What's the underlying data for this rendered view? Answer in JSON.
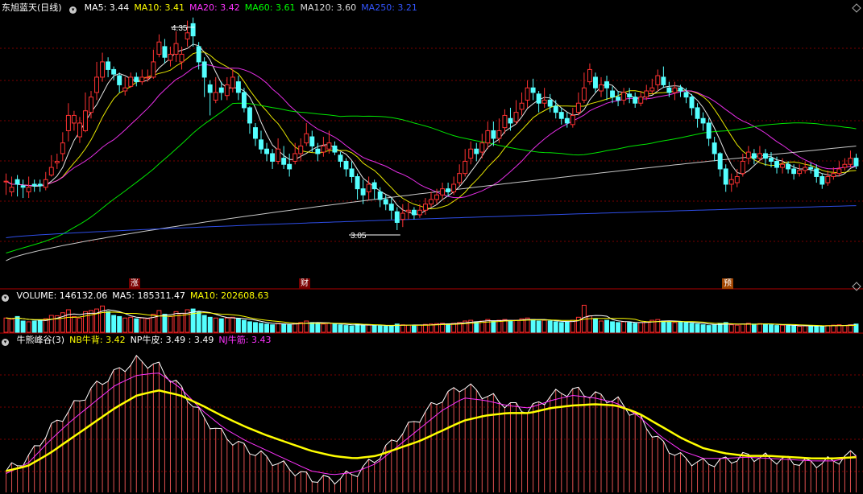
{
  "main_legend": {
    "title": "东旭蓝天(日线)",
    "items": [
      {
        "label": "MA5: 3.44",
        "color": "#ffffff"
      },
      {
        "label": "MA10: 3.41",
        "color": "#ffff00"
      },
      {
        "label": "MA20: 3.42",
        "color": "#ff33ff"
      },
      {
        "label": "MA60: 3.61",
        "color": "#00ff00"
      },
      {
        "label": "MA120: 3.60",
        "color": "#dddddd"
      },
      {
        "label": "MA250: 3.21",
        "color": "#3355ff"
      }
    ]
  },
  "volume_legend": {
    "items": [
      {
        "label": "VOLUME: 146132.06",
        "color": "#ffffff"
      },
      {
        "label": "MA5: 185311.47",
        "color": "#ffffff"
      },
      {
        "label": "MA10: 202608.63",
        "color": "#ffff00"
      }
    ]
  },
  "indicator_legend": {
    "items": [
      {
        "label": "牛熊峰谷(3)",
        "color": "#ffffff"
      },
      {
        "label": "NB牛背: 3.42",
        "color": "#ffff00"
      },
      {
        "label": "NP牛皮: 3.49 : 3.49",
        "color": "#ffffff"
      },
      {
        "label": "NJ牛筋: 3.43",
        "color": "#ff33ff"
      }
    ]
  },
  "markers": {
    "zhang": "涨",
    "cai": "财",
    "yu": "预"
  },
  "annotations": {
    "high": "4.35",
    "low": "3.05"
  },
  "colors": {
    "up": "#ff3232",
    "down": "#54ffff",
    "grid": "#7a0000",
    "divider": "#b00000"
  },
  "chart_data": {
    "type": "candlestick",
    "title": "东旭蓝天(日线)",
    "price_range": [
      2.75,
      4.46
    ],
    "high_mark": 4.35,
    "low_mark": 3.05,
    "candles": [
      [
        3.37,
        3.37,
        3.42,
        3.28
      ],
      [
        3.3,
        3.33,
        3.4,
        3.27
      ],
      [
        3.38,
        3.35,
        3.41,
        3.27
      ],
      [
        3.34,
        3.33,
        3.38,
        3.26
      ],
      [
        3.3,
        3.33,
        3.4,
        3.26
      ],
      [
        3.35,
        3.34,
        3.38,
        3.3
      ],
      [
        3.35,
        3.34,
        3.38,
        3.3
      ],
      [
        3.33,
        3.38,
        3.43,
        3.31
      ],
      [
        3.41,
        3.46,
        3.54,
        3.4
      ],
      [
        3.49,
        3.5,
        3.55,
        3.45
      ],
      [
        3.55,
        3.62,
        3.69,
        3.5
      ],
      [
        3.7,
        3.8,
        3.88,
        3.63
      ],
      [
        3.75,
        3.8,
        3.83,
        3.7
      ],
      [
        3.66,
        3.75,
        3.79,
        3.62
      ],
      [
        3.7,
        3.83,
        3.95,
        3.69
      ],
      [
        3.82,
        3.92,
        3.96,
        3.78
      ],
      [
        3.95,
        4.05,
        4.15,
        3.9
      ],
      [
        4.05,
        4.15,
        4.21,
        4.02
      ],
      [
        4.15,
        4.1,
        4.18,
        4.05
      ],
      [
        4.1,
        4.07,
        4.12,
        4.03
      ],
      [
        4.06,
        4.0,
        4.08,
        3.95
      ],
      [
        3.96,
        3.98,
        4.05,
        3.93
      ],
      [
        3.99,
        4.05,
        4.08,
        3.98
      ],
      [
        4.05,
        4.02,
        4.08,
        3.99
      ],
      [
        4.02,
        4.05,
        4.1,
        4.0
      ],
      [
        4.05,
        4.05,
        4.1,
        4.02
      ],
      [
        4.05,
        4.15,
        4.23,
        4.04
      ],
      [
        4.2,
        4.28,
        4.33,
        4.18
      ],
      [
        4.25,
        4.18,
        4.3,
        4.14
      ],
      [
        4.16,
        4.2,
        4.25,
        4.12
      ],
      [
        4.2,
        4.27,
        4.35,
        4.15
      ],
      [
        4.15,
        4.2,
        4.25,
        4.1
      ],
      [
        4.3,
        4.34,
        4.42,
        4.25
      ],
      [
        4.4,
        4.32,
        4.44,
        4.25
      ],
      [
        4.25,
        4.15,
        4.28,
        4.1
      ],
      [
        4.15,
        4.05,
        4.18,
        3.92
      ],
      [
        4.0,
        3.95,
        4.03,
        3.8
      ],
      [
        3.9,
        3.95,
        4.05,
        3.88
      ],
      [
        3.98,
        3.95,
        4.02,
        3.9
      ],
      [
        3.93,
        4.0,
        4.05,
        3.9
      ],
      [
        3.98,
        4.05,
        4.1,
        3.95
      ],
      [
        4.02,
        3.95,
        4.06,
        3.9
      ],
      [
        3.95,
        3.85,
        3.98,
        3.82
      ],
      [
        3.85,
        3.75,
        3.86,
        3.68
      ],
      [
        3.72,
        3.65,
        3.75,
        3.6
      ],
      [
        3.64,
        3.58,
        3.7,
        3.55
      ],
      [
        3.58,
        3.55,
        3.62,
        3.5
      ],
      [
        3.55,
        3.5,
        3.58,
        3.45
      ],
      [
        3.5,
        3.58,
        3.65,
        3.48
      ],
      [
        3.52,
        3.48,
        3.6,
        3.45
      ],
      [
        3.48,
        3.45,
        3.55,
        3.4
      ],
      [
        3.5,
        3.55,
        3.62,
        3.48
      ],
      [
        3.55,
        3.6,
        3.65,
        3.5
      ],
      [
        3.62,
        3.68,
        3.75,
        3.6
      ],
      [
        3.66,
        3.6,
        3.7,
        3.56
      ],
      [
        3.58,
        3.55,
        3.62,
        3.5
      ],
      [
        3.56,
        3.6,
        3.66,
        3.53
      ],
      [
        3.58,
        3.62,
        3.7,
        3.55
      ],
      [
        3.6,
        3.56,
        3.63,
        3.54
      ],
      [
        3.54,
        3.5,
        3.56,
        3.46
      ],
      [
        3.5,
        3.45,
        3.52,
        3.4
      ],
      [
        3.45,
        3.4,
        3.5,
        3.36
      ],
      [
        3.4,
        3.32,
        3.42,
        3.25
      ],
      [
        3.32,
        3.28,
        3.38,
        3.22
      ],
      [
        3.3,
        3.35,
        3.4,
        3.25
      ],
      [
        3.36,
        3.32,
        3.38,
        3.25
      ],
      [
        3.3,
        3.25,
        3.33,
        3.2
      ],
      [
        3.25,
        3.22,
        3.28,
        3.18
      ],
      [
        3.22,
        3.18,
        3.26,
        3.12
      ],
      [
        3.17,
        3.1,
        3.2,
        3.05
      ],
      [
        3.12,
        3.16,
        3.22,
        3.07
      ],
      [
        3.17,
        3.18,
        3.23,
        3.12
      ],
      [
        3.18,
        3.15,
        3.2,
        3.12
      ],
      [
        3.15,
        3.18,
        3.22,
        3.13
      ],
      [
        3.18,
        3.22,
        3.26,
        3.15
      ],
      [
        3.22,
        3.25,
        3.3,
        3.2
      ],
      [
        3.25,
        3.28,
        3.32,
        3.22
      ],
      [
        3.28,
        3.32,
        3.36,
        3.25
      ],
      [
        3.32,
        3.3,
        3.36,
        3.27
      ],
      [
        3.3,
        3.35,
        3.4,
        3.28
      ],
      [
        3.36,
        3.42,
        3.48,
        3.34
      ],
      [
        3.42,
        3.5,
        3.58,
        3.4
      ],
      [
        3.52,
        3.58,
        3.63,
        3.48
      ],
      [
        3.58,
        3.55,
        3.62,
        3.5
      ],
      [
        3.56,
        3.62,
        3.68,
        3.52
      ],
      [
        3.62,
        3.7,
        3.76,
        3.58
      ],
      [
        3.7,
        3.65,
        3.76,
        3.6
      ],
      [
        3.65,
        3.7,
        3.78,
        3.62
      ],
      [
        3.72,
        3.8,
        3.84,
        3.68
      ],
      [
        3.78,
        3.75,
        3.85,
        3.7
      ],
      [
        3.76,
        3.82,
        3.9,
        3.74
      ],
      [
        3.84,
        3.88,
        3.95,
        3.8
      ],
      [
        3.9,
        3.98,
        4.03,
        3.85
      ],
      [
        3.98,
        3.95,
        4.04,
        3.9
      ],
      [
        3.94,
        3.88,
        3.96,
        3.82
      ],
      [
        3.88,
        3.9,
        3.98,
        3.85
      ],
      [
        3.9,
        3.86,
        3.94,
        3.82
      ],
      [
        3.86,
        3.82,
        3.9,
        3.78
      ],
      [
        3.82,
        3.78,
        3.85,
        3.74
      ],
      [
        3.78,
        3.75,
        3.82,
        3.72
      ],
      [
        3.74,
        3.8,
        3.85,
        3.72
      ],
      [
        3.82,
        3.88,
        3.95,
        3.8
      ],
      [
        3.9,
        3.98,
        4.08,
        3.88
      ],
      [
        4.02,
        4.1,
        4.14,
        4.0
      ],
      [
        4.05,
        3.98,
        4.08,
        3.95
      ],
      [
        3.96,
        4.0,
        4.05,
        3.92
      ],
      [
        4.02,
        3.98,
        4.06,
        3.9
      ],
      [
        3.96,
        3.92,
        3.99,
        3.88
      ],
      [
        3.92,
        3.9,
        3.96,
        3.86
      ],
      [
        3.9,
        3.95,
        3.98,
        3.87
      ],
      [
        3.94,
        3.92,
        3.98,
        3.88
      ],
      [
        3.92,
        3.88,
        3.95,
        3.85
      ],
      [
        3.88,
        3.92,
        3.96,
        3.86
      ],
      [
        3.92,
        3.96,
        4.0,
        3.9
      ],
      [
        3.96,
        3.98,
        4.04,
        3.94
      ],
      [
        4.0,
        4.06,
        4.1,
        3.96
      ],
      [
        4.05,
        4.0,
        4.12,
        3.98
      ],
      [
        3.98,
        3.95,
        4.02,
        3.92
      ],
      [
        3.95,
        3.98,
        4.02,
        3.9
      ],
      [
        3.98,
        3.96,
        4.0,
        3.92
      ],
      [
        3.95,
        3.92,
        3.98,
        3.88
      ],
      [
        3.92,
        3.85,
        3.94,
        3.8
      ],
      [
        3.85,
        3.78,
        3.88,
        3.72
      ],
      [
        3.78,
        3.75,
        3.82,
        3.7
      ],
      [
        3.75,
        3.65,
        3.78,
        3.6
      ],
      [
        3.62,
        3.55,
        3.66,
        3.5
      ],
      [
        3.55,
        3.45,
        3.56,
        3.4
      ],
      [
        3.45,
        3.35,
        3.48,
        3.3
      ],
      [
        3.35,
        3.38,
        3.42,
        3.3
      ],
      [
        3.36,
        3.4,
        3.45,
        3.33
      ],
      [
        3.42,
        3.5,
        3.55,
        3.4
      ],
      [
        3.52,
        3.56,
        3.6,
        3.48
      ],
      [
        3.55,
        3.52,
        3.58,
        3.48
      ],
      [
        3.52,
        3.55,
        3.6,
        3.5
      ],
      [
        3.55,
        3.52,
        3.58,
        3.47
      ],
      [
        3.52,
        3.5,
        3.56,
        3.46
      ],
      [
        3.5,
        3.46,
        3.53,
        3.42
      ],
      [
        3.46,
        3.48,
        3.52,
        3.42
      ],
      [
        3.48,
        3.45,
        3.5,
        3.42
      ],
      [
        3.45,
        3.42,
        3.48,
        3.38
      ],
      [
        3.42,
        3.44,
        3.48,
        3.4
      ],
      [
        3.44,
        3.46,
        3.5,
        3.42
      ],
      [
        3.46,
        3.45,
        3.49,
        3.42
      ],
      [
        3.45,
        3.4,
        3.48,
        3.36
      ],
      [
        3.4,
        3.35,
        3.42,
        3.32
      ],
      [
        3.36,
        3.4,
        3.44,
        3.34
      ],
      [
        3.4,
        3.42,
        3.46,
        3.38
      ],
      [
        3.42,
        3.45,
        3.5,
        3.4
      ],
      [
        3.46,
        3.48,
        3.52,
        3.44
      ],
      [
        3.48,
        3.52,
        3.57,
        3.46
      ],
      [
        3.52,
        3.47,
        3.55,
        3.45
      ]
    ],
    "volume": [
      38,
      35,
      42,
      30,
      28,
      30,
      32,
      36,
      45,
      44,
      52,
      60,
      42,
      38,
      55,
      58,
      62,
      70,
      55,
      45,
      42,
      38,
      40,
      36,
      38,
      36,
      48,
      58,
      48,
      42,
      55,
      50,
      60,
      62,
      55,
      45,
      40,
      38,
      36,
      38,
      40,
      36,
      32,
      28,
      26,
      24,
      22,
      20,
      24,
      22,
      20,
      24,
      26,
      30,
      26,
      24,
      22,
      24,
      22,
      20,
      18,
      17,
      22,
      20,
      19,
      18,
      17,
      16,
      18,
      22,
      20,
      19,
      18,
      19,
      21,
      22,
      23,
      24,
      22,
      24,
      26,
      30,
      32,
      28,
      30,
      34,
      30,
      32,
      34,
      30,
      32,
      36,
      38,
      34,
      30,
      32,
      30,
      28,
      26,
      28,
      32,
      40,
      72,
      44,
      36,
      30,
      32,
      28,
      26,
      28,
      26,
      24,
      26,
      28,
      32,
      34,
      30,
      28,
      26,
      28,
      26,
      24,
      22,
      20,
      18,
      20,
      24,
      26,
      20,
      19,
      22,
      24,
      22,
      23,
      22,
      20,
      18,
      19,
      18,
      17,
      16,
      17,
      18,
      17,
      16,
      18,
      19,
      20,
      18,
      20,
      22
    ],
    "volume_max": 75,
    "indicator": {
      "range": [
        -0.05,
        1.1
      ],
      "series": [
        {
          "name": "NB牛背",
          "values": [
            0.12,
            0.22,
            0.45,
            0.62,
            0.78,
            0.9,
            1.0,
            0.95,
            0.78,
            0.55,
            0.4,
            0.3,
            0.22,
            0.14,
            0.06,
            0.05,
            0.1,
            0.22,
            0.4,
            0.55,
            0.7,
            0.8,
            0.72,
            0.65,
            0.6,
            0.72,
            0.76,
            0.72,
            0.68,
            0.55,
            0.35,
            0.22,
            0.18,
            0.2,
            0.24,
            0.22,
            0.2,
            0.18,
            0.2,
            0.26
          ]
        },
        {
          "name": "NP牛皮",
          "values": [
            0.12,
            0.16,
            0.26,
            0.38,
            0.5,
            0.62,
            0.72,
            0.76,
            0.72,
            0.64,
            0.55,
            0.47,
            0.4,
            0.34,
            0.28,
            0.24,
            0.22,
            0.24,
            0.3,
            0.36,
            0.44,
            0.52,
            0.56,
            0.58,
            0.58,
            0.62,
            0.64,
            0.65,
            0.64,
            0.58,
            0.48,
            0.38,
            0.3,
            0.26,
            0.24,
            0.24,
            0.23,
            0.22,
            0.22,
            0.23
          ]
        },
        {
          "name": "NJ牛筋",
          "values": [
            0.1,
            0.18,
            0.36,
            0.52,
            0.66,
            0.8,
            0.88,
            0.9,
            0.78,
            0.6,
            0.46,
            0.36,
            0.28,
            0.2,
            0.12,
            0.09,
            0.11,
            0.18,
            0.32,
            0.46,
            0.6,
            0.7,
            0.68,
            0.64,
            0.62,
            0.68,
            0.72,
            0.7,
            0.66,
            0.56,
            0.4,
            0.28,
            0.22,
            0.22,
            0.23,
            0.22,
            0.21,
            0.2,
            0.2,
            0.24
          ]
        }
      ]
    }
  }
}
